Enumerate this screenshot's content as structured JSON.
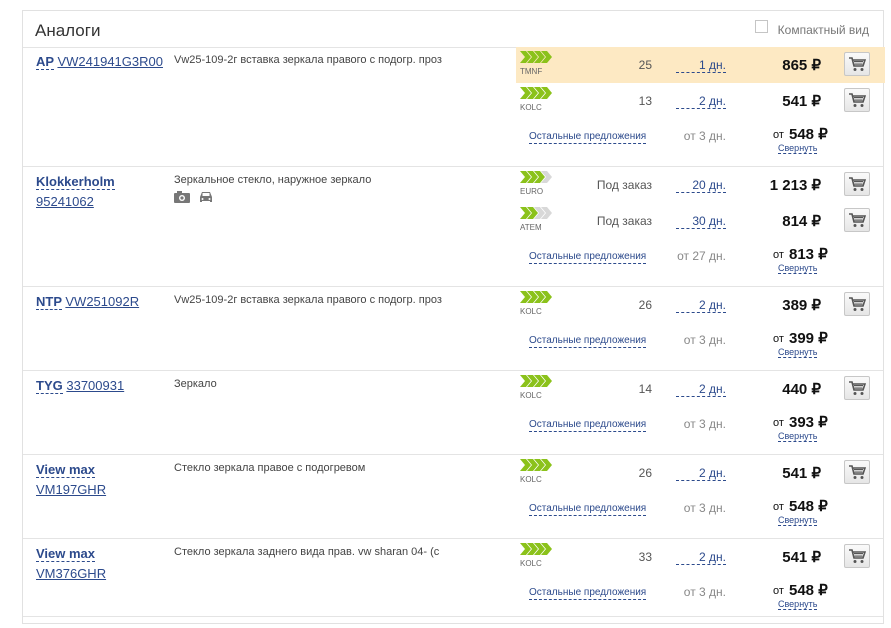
{
  "header": {
    "title": "Аналоги",
    "compact_label": "Компактный вид"
  },
  "colors": {
    "link": "#2c4a8c",
    "highlight": "#fde9c3",
    "arrow": "#8bc21b"
  },
  "rows": [
    {
      "brand": "AP",
      "code": "VW241941G3R00",
      "layout": "inline",
      "description": "Vw25-109-2г вставка зеркала правого с подогр. проз",
      "offers": [
        {
          "supplier": "TMNF",
          "qty": "25",
          "days": "1 дн.",
          "price": "865 ₽",
          "highlight": true,
          "arrows": 4
        },
        {
          "supplier": "KOLC",
          "qty": "13",
          "days": "2 дн.",
          "price": "541 ₽",
          "highlight": false,
          "arrows": 4
        }
      ],
      "others": {
        "label": "Остальные предложения",
        "days": "от 3 дн.",
        "from": "от",
        "price": "548 ₽",
        "collapse": "Свернуть"
      }
    },
    {
      "brand": "Klokkerholm",
      "code": "95241062",
      "layout": "below",
      "icons": [
        "camera-icon",
        "car-icon"
      ],
      "description": "Зеркальное стекло, наружное зеркало",
      "offers": [
        {
          "supplier": "EURO",
          "qty": "Под заказ",
          "days": "20 дн.",
          "price": "1 213 ₽",
          "highlight": false,
          "arrows": 3
        },
        {
          "supplier": "ATEM",
          "qty": "Под заказ",
          "days": "30 дн.",
          "price": "814 ₽",
          "highlight": false,
          "arrows": 2
        }
      ],
      "others": {
        "label": "Остальные предложения",
        "days": "от 27 дн.",
        "from": "от",
        "price": "813 ₽",
        "collapse": "Свернуть"
      }
    },
    {
      "brand": "NTP",
      "code": "VW251092R",
      "layout": "inline",
      "description": "Vw25-109-2г вставка зеркала правого с подогр. проз",
      "offers": [
        {
          "supplier": "KOLC",
          "qty": "26",
          "days": "2 дн.",
          "price": "389 ₽",
          "highlight": false,
          "arrows": 4
        }
      ],
      "others": {
        "label": "Остальные предложения",
        "days": "от 3 дн.",
        "from": "от",
        "price": "399 ₽",
        "collapse": "Свернуть"
      }
    },
    {
      "brand": "TYG",
      "code": "33700931",
      "layout": "inline",
      "description": "Зеркало",
      "offers": [
        {
          "supplier": "KOLC",
          "qty": "14",
          "days": "2 дн.",
          "price": "440 ₽",
          "highlight": false,
          "arrows": 4
        }
      ],
      "others": {
        "label": "Остальные предложения",
        "days": "от 3 дн.",
        "from": "от",
        "price": "393 ₽",
        "collapse": "Свернуть"
      }
    },
    {
      "brand": "View max",
      "code": "VM197GHR",
      "layout": "below",
      "description": "Стекло зеркала правое с подогревом",
      "offers": [
        {
          "supplier": "KOLC",
          "qty": "26",
          "days": "2 дн.",
          "price": "541 ₽",
          "highlight": false,
          "arrows": 4
        }
      ],
      "others": {
        "label": "Остальные предложения",
        "days": "от 3 дн.",
        "from": "от",
        "price": "548 ₽",
        "collapse": "Свернуть"
      }
    },
    {
      "brand": "View max",
      "code": "VM376GHR",
      "layout": "below",
      "description": "Стекло зеркала заднего вида прав. vw sharan 04- (с",
      "offers": [
        {
          "supplier": "KOLC",
          "qty": "33",
          "days": "2 дн.",
          "price": "541 ₽",
          "highlight": false,
          "arrows": 4
        }
      ],
      "others": {
        "label": "Остальные предложения",
        "days": "от 3 дн.",
        "from": "от",
        "price": "548 ₽",
        "collapse": "Свернуть"
      }
    }
  ]
}
